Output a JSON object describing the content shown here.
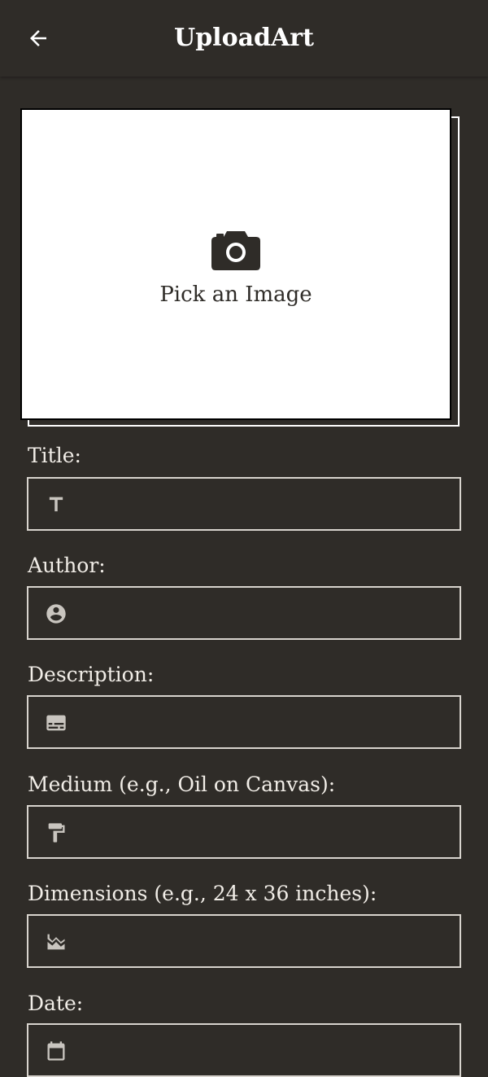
{
  "app_bar": {
    "title": "UploadArt",
    "back_icon": "arrow-left-icon"
  },
  "image_picker": {
    "label": "Pick an Image",
    "icon": "camera-icon"
  },
  "fields": {
    "title": {
      "label": "Title:",
      "value": "",
      "icon": "title-icon"
    },
    "author": {
      "label": "Author:",
      "value": "",
      "icon": "account-circle-icon"
    },
    "description": {
      "label": "Description:",
      "value": "",
      "icon": "subtitles-icon"
    },
    "medium": {
      "label": "Medium (e.g., Oil on Canvas):",
      "value": "",
      "icon": "format-paint-icon"
    },
    "dimensions": {
      "label": "Dimensions (e.g., 24 x 36 inches):",
      "value": "",
      "icon": "landscape-icon"
    },
    "date": {
      "label": "Date:",
      "value": "",
      "icon": "calendar-icon"
    }
  },
  "colors": {
    "background": "#2f2c28",
    "field_border": "#d8d4ce",
    "icon_gray": "#c9c5bf",
    "text": "#f1ede7"
  }
}
